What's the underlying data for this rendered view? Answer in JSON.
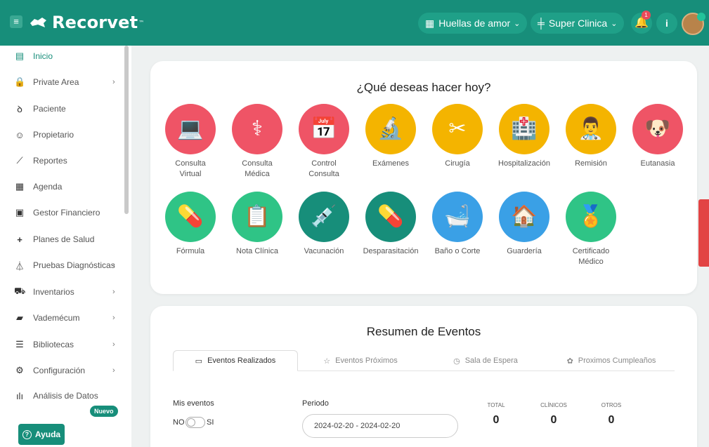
{
  "header": {
    "brand": "Recorvet",
    "brand_tm": "™",
    "clinic_selector": "Huellas de amor",
    "branch_selector": "Super Clinica",
    "notification_count": "1"
  },
  "sidebar": {
    "items": [
      {
        "label": "Inicio"
      },
      {
        "label": "Private Area"
      },
      {
        "label": "Paciente"
      },
      {
        "label": "Propietario"
      },
      {
        "label": "Reportes"
      },
      {
        "label": "Agenda"
      },
      {
        "label": "Gestor Financiero"
      },
      {
        "label": "Planes de Salud"
      },
      {
        "label": "Pruebas Diagnósticas"
      },
      {
        "label": "Inventarios"
      },
      {
        "label": "Vademécum"
      },
      {
        "label": "Bibliotecas"
      },
      {
        "label": "Configuración"
      },
      {
        "label": "Análisis de Datos"
      }
    ],
    "new_badge": "Nuevo",
    "help_button": "Ayuda"
  },
  "actions_card": {
    "title": "¿Qué deseas hacer hoy?",
    "actions": [
      {
        "line1": "Consulta",
        "line2": "Virtual",
        "color": "#ef5466"
      },
      {
        "line1": "Consulta",
        "line2": "Médica",
        "color": "#ef5466"
      },
      {
        "line1": "Control",
        "line2": "Consulta",
        "color": "#ef5466"
      },
      {
        "line1": "Exámenes",
        "line2": "",
        "color": "#f4b400"
      },
      {
        "line1": "Cirugía",
        "line2": "",
        "color": "#f4b400"
      },
      {
        "line1": "Hospitalización",
        "line2": "",
        "color": "#f4b400"
      },
      {
        "line1": "Remisión",
        "line2": "",
        "color": "#f4b400"
      },
      {
        "line1": "Eutanasia",
        "line2": "",
        "color": "#ef5466"
      },
      {
        "line1": "Fórmula",
        "line2": "",
        "color": "#2fc486"
      },
      {
        "line1": "Nota Clínica",
        "line2": "",
        "color": "#2fc486"
      },
      {
        "line1": "Vacunación",
        "line2": "",
        "color": "#178e7a"
      },
      {
        "line1": "Desparasitación",
        "line2": "",
        "color": "#178e7a"
      },
      {
        "line1": "Baño o Corte",
        "line2": "",
        "color": "#3aa0e6"
      },
      {
        "line1": "Guardería",
        "line2": "",
        "color": "#3aa0e6"
      },
      {
        "line1": "Certificado",
        "line2": "Médico",
        "color": "#2fc486"
      }
    ]
  },
  "events_card": {
    "title": "Resumen de Eventos",
    "tabs": [
      {
        "label": "Eventos Realizados"
      },
      {
        "label": "Eventos Próximos"
      },
      {
        "label": "Sala de Espera"
      },
      {
        "label": "Proximos Cumpleaños"
      }
    ],
    "my_events_label": "Mis eventos",
    "toggle_off": "NO",
    "toggle_on": "SI",
    "period_label": "Periodo",
    "period_value": "2024-02-20 - 2024-02-20",
    "stats": [
      {
        "label": "TOTAL",
        "value": "0"
      },
      {
        "label": "CLÍNICOS",
        "value": "0"
      },
      {
        "label": "OTROS",
        "value": "0"
      }
    ]
  }
}
